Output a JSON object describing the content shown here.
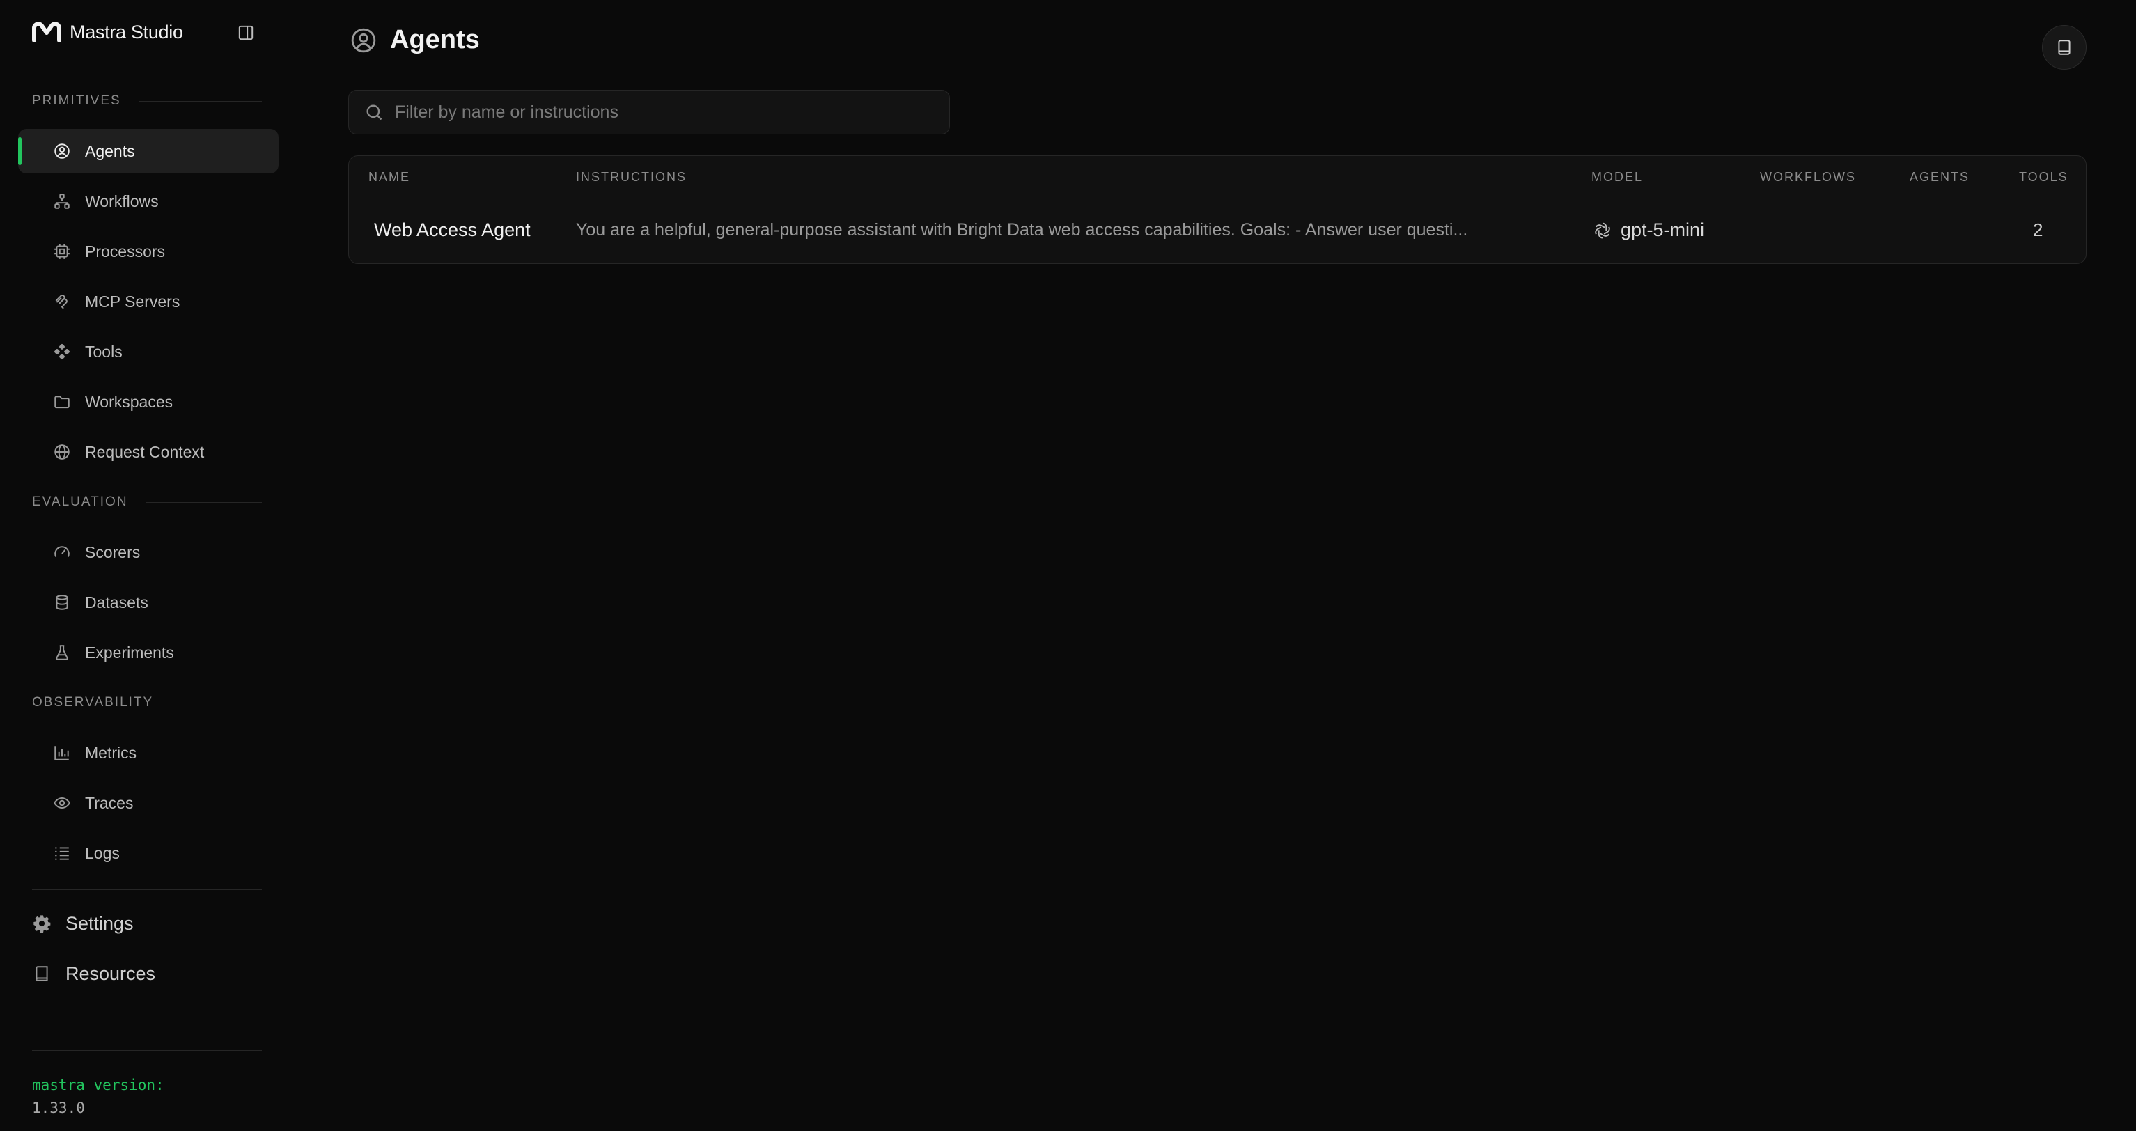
{
  "app": {
    "brand_name": "Mastra Studio"
  },
  "sidebar": {
    "sections": {
      "primitives": "PRIMITIVES",
      "evaluation": "EVALUATION",
      "observability": "OBSERVABILITY"
    },
    "items": [
      {
        "label": "Agents",
        "icon": "agent-icon",
        "active": true
      },
      {
        "label": "Workflows",
        "icon": "workflow-icon"
      },
      {
        "label": "Processors",
        "icon": "processor-icon"
      },
      {
        "label": "MCP Servers",
        "icon": "mcp-icon"
      },
      {
        "label": "Tools",
        "icon": "tools-icon"
      },
      {
        "label": "Workspaces",
        "icon": "folder-icon"
      },
      {
        "label": "Request Context",
        "icon": "globe-icon"
      },
      {
        "label": "Scorers",
        "icon": "gauge-icon"
      },
      {
        "label": "Datasets",
        "icon": "database-icon"
      },
      {
        "label": "Experiments",
        "icon": "flask-icon"
      },
      {
        "label": "Metrics",
        "icon": "bar-chart-icon"
      },
      {
        "label": "Traces",
        "icon": "eye-icon"
      },
      {
        "label": "Logs",
        "icon": "list-icon"
      }
    ],
    "bottom": [
      {
        "label": "Settings",
        "icon": "gear-icon"
      },
      {
        "label": "Resources",
        "icon": "book-icon"
      }
    ],
    "version_label": "mastra version:",
    "version_value": "1.33.0"
  },
  "main": {
    "title": "Agents",
    "search_placeholder": "Filter by name or instructions",
    "table": {
      "columns": [
        "NAME",
        "INSTRUCTIONS",
        "MODEL",
        "WORKFLOWS",
        "AGENTS",
        "TOOLS"
      ],
      "rows": [
        {
          "name": "Web Access Agent",
          "instructions": "You are a helpful, general-purpose assistant with Bright Data web access capabilities. Goals: - Answer user questi...",
          "model": "gpt-5-mini",
          "workflows": "",
          "agents": "",
          "tools": "2"
        }
      ]
    }
  },
  "colors": {
    "accent": "#22c55e",
    "background": "#0a0a0a"
  }
}
